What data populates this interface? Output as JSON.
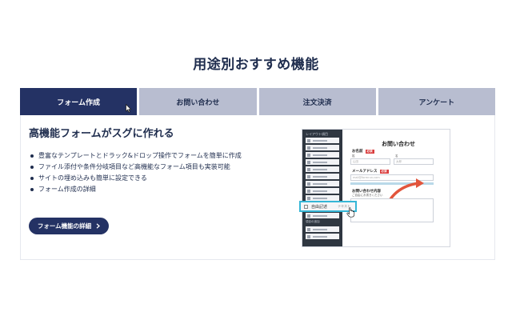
{
  "section": {
    "title": "用途別おすすめ機能"
  },
  "tabs": [
    {
      "label": "フォーム作成",
      "active": true
    },
    {
      "label": "お問い合わせ",
      "active": false
    },
    {
      "label": "注文決済",
      "active": false
    },
    {
      "label": "アンケート",
      "active": false
    }
  ],
  "panel": {
    "heading": "高機能フォームがスグに作れる",
    "features": [
      "豊富なテンプレートとドラック&ドロップ操作でフォームを簡単に作成",
      "ファイル添付や条件分岐項目など高機能なフォーム項目も実装可能",
      "サイトの埋め込みも簡単に設定できる",
      "フォーム作成の詳細"
    ],
    "detail_button": "フォーム機能の詳細"
  },
  "mock": {
    "title": "お問い合わせ",
    "side_heading": "レイアウト項目",
    "side_sub": "項目の追加",
    "name_label": "お名前",
    "required": "必須",
    "last_name": "姓",
    "first_name": "名",
    "last_ph": "山田",
    "first_ph": "太郎",
    "email_label": "メールアドレス",
    "email_ph": "mail@formrun.com",
    "inquiry_label": "お問い合わせ内容",
    "inquiry_sub": "ご自由にお書きください",
    "drag_label": "自由記述",
    "drag_right": "テキスト"
  },
  "colors": {
    "navy": "#243264",
    "tab_inactive": "#b8bdd0",
    "accent": "#35b6d6",
    "arrow": "#e2553c"
  }
}
